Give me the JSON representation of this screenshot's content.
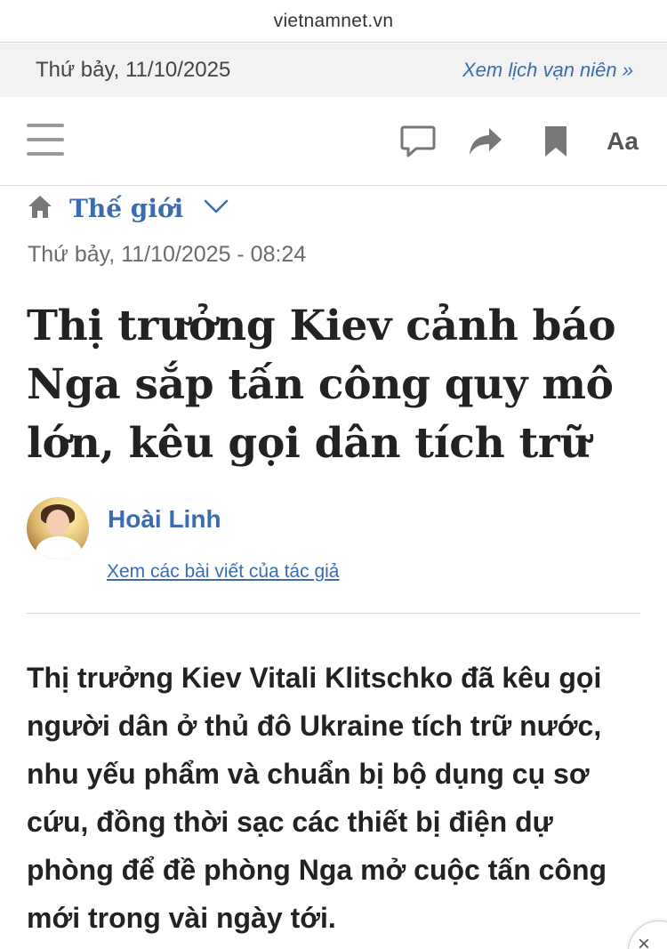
{
  "browser": {
    "domain": "vietnamnet.vn"
  },
  "date_strip": {
    "today": "Thứ bảy, 11/10/2025",
    "calendar_link": "Xem lịch vạn niên »"
  },
  "toolbar": {
    "font_size_label": "Aa"
  },
  "breadcrumb": {
    "category": "Thế giới"
  },
  "article": {
    "published": "Thứ bảy, 11/10/2025 - 08:24",
    "title": "Thị trưởng Kiev cảnh báo Nga sắp tấn công quy mô lớn, kêu gọi dân tích trữ",
    "author": {
      "name": "Hoài Linh",
      "link_text": "Xem các bài viết của tác giả"
    },
    "sapo": "Thị trưởng Kiev Vitali Klitschko đã kêu gọi người dân ở thủ đô Ukraine tích trữ nước, nhu yếu phẩm và chuẩn bị bộ dụng cụ sơ cứu, đồng thời sạc các thiết bị điện dự phòng để đề phòng Nga mở cuộc tấn công mới trong vài ngày tới."
  },
  "floating": {
    "close_glyph": "×"
  },
  "icons": {
    "menu": "hamburger-menu-icon",
    "comment": "comment-icon",
    "share": "share-icon",
    "bookmark": "bookmark-icon",
    "home": "home-icon",
    "chevron": "chevron-down-icon"
  },
  "colors": {
    "accent": "#3b6bb0",
    "text": "#222222",
    "muted": "#6b6b6b",
    "strip_bg": "#f2f2f2"
  }
}
